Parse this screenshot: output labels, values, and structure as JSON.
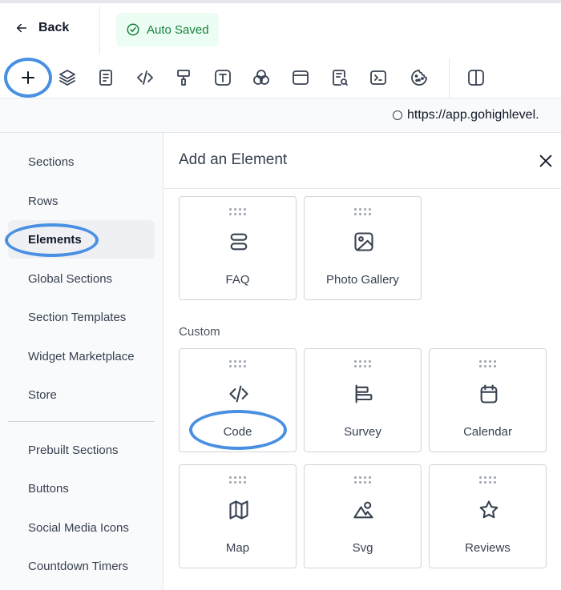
{
  "header": {
    "back_label": "Back",
    "status_label": "Auto Saved"
  },
  "toolbar": {
    "tools": [
      "plus-icon",
      "layers-icon",
      "document-icon",
      "code-icon",
      "paint-roller-icon",
      "text-icon",
      "color-circles-icon",
      "window-icon",
      "search-doc-icon",
      "terminal-icon",
      "palette-icon",
      "split-view-icon"
    ]
  },
  "url": {
    "text": "https://app.gohighlevel."
  },
  "sidebar": {
    "items": [
      {
        "label": "Sections"
      },
      {
        "label": "Rows"
      },
      {
        "label": "Elements"
      },
      {
        "label": "Global Sections"
      },
      {
        "label": "Section Templates"
      },
      {
        "label": "Widget Marketplace"
      },
      {
        "label": "Store"
      },
      {
        "label": "Prebuilt Sections"
      },
      {
        "label": "Buttons"
      },
      {
        "label": "Social Media Icons"
      },
      {
        "label": "Countdown Timers"
      }
    ],
    "active": "Elements"
  },
  "panel": {
    "title": "Add an Element",
    "custom_label": "Custom",
    "cards": [
      {
        "label": "FAQ",
        "icon": "faq-icon"
      },
      {
        "label": "Photo Gallery",
        "icon": "image-icon"
      },
      {
        "label": "Code",
        "icon": "code-icon"
      },
      {
        "label": "Survey",
        "icon": "survey-icon"
      },
      {
        "label": "Calendar",
        "icon": "calendar-icon"
      },
      {
        "label": "Map",
        "icon": "map-icon"
      },
      {
        "label": "Svg",
        "icon": "svg-icon"
      },
      {
        "label": "Reviews",
        "icon": "star-icon"
      }
    ]
  },
  "colors": {
    "accent_ring": "#4a90e2",
    "saved_green": "#15803d"
  }
}
